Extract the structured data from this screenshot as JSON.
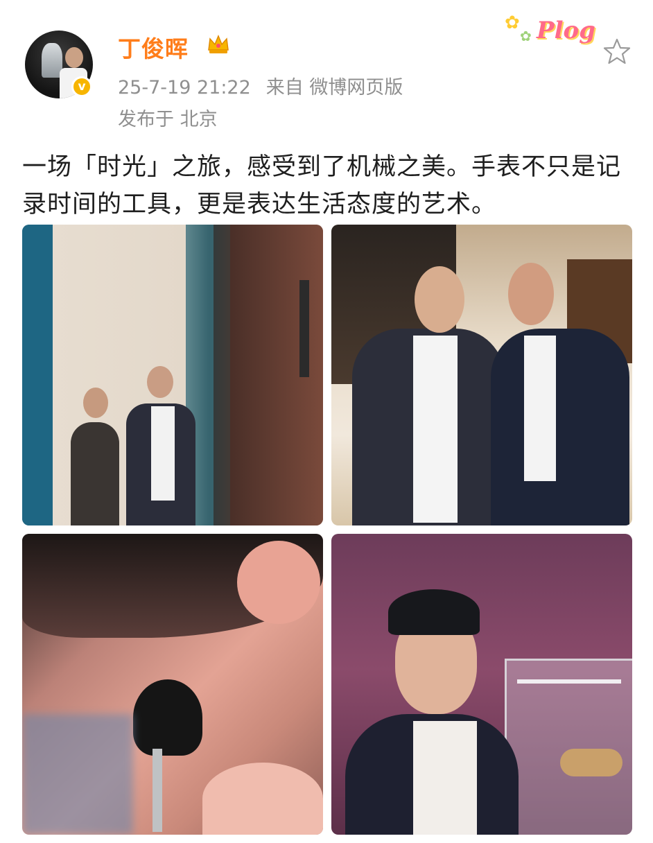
{
  "post": {
    "username": "丁俊晖",
    "timestamp": "25-7-19 21:22",
    "source": "来自 微博网页版",
    "location": "发布于 北京",
    "text": "一场「时光」之旅，感受到了机械之美。手表不只是记录时间的工具，更是表达生活态度的艺术。",
    "verified_mark": "v",
    "decor_text": "Plog"
  },
  "colors": {
    "username": "#ff7d1a",
    "meta": "#8f8f8f",
    "verified": "#f7b500",
    "body_text": "#1e1e1e"
  },
  "icons": [
    "crown-icon",
    "verified-badge-icon",
    "star-icon",
    "plog-sticker-icon"
  ]
}
